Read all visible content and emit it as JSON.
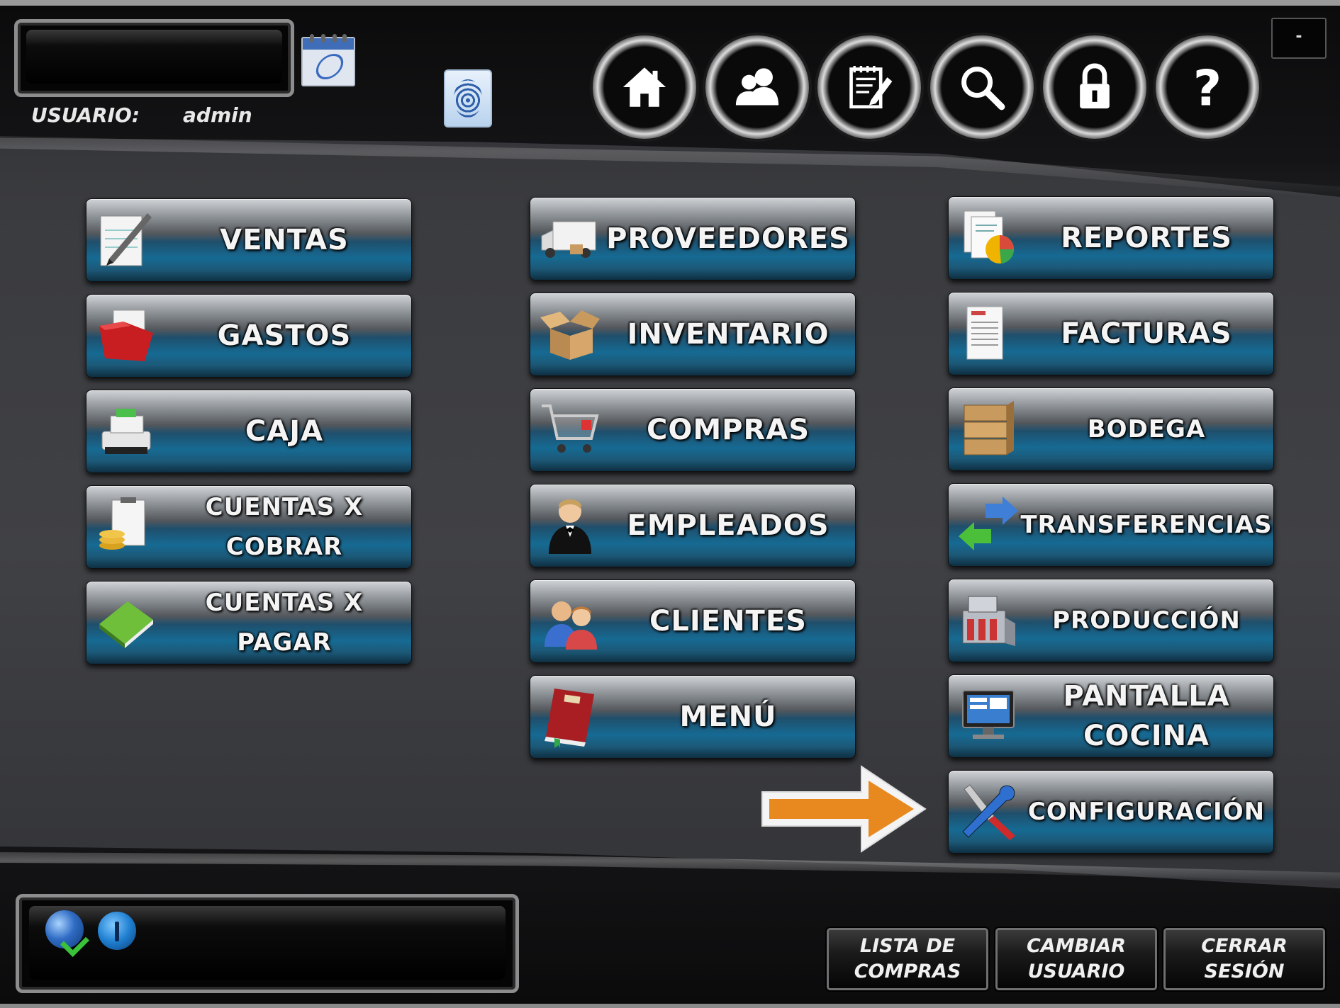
{
  "header": {
    "user_label": "USUARIO:",
    "user_value": "admin",
    "minimize_label": "-",
    "nav": [
      {
        "icon": "home-icon"
      },
      {
        "icon": "users-icon"
      },
      {
        "icon": "notepad-edit-icon"
      },
      {
        "icon": "search-icon"
      },
      {
        "icon": "lock-icon"
      },
      {
        "icon": "help-icon"
      }
    ]
  },
  "menu": {
    "col1": [
      {
        "label": "VENTAS",
        "icon": "pen-paper-icon"
      },
      {
        "label": "GASTOS",
        "icon": "red-folder-icon"
      },
      {
        "label": "CAJA",
        "icon": "cash-register-icon"
      },
      {
        "label": "CUENTAS X\nCOBRAR",
        "icon": "coins-clipboard-icon"
      },
      {
        "label": "CUENTAS X\nPAGAR",
        "icon": "green-book-icon"
      }
    ],
    "col2": [
      {
        "label": "PROVEEDORES",
        "icon": "delivery-truck-icon"
      },
      {
        "label": "INVENTARIO",
        "icon": "open-box-icon"
      },
      {
        "label": "COMPRAS",
        "icon": "shopping-cart-icon"
      },
      {
        "label": "EMPLEADOS",
        "icon": "waiter-icon"
      },
      {
        "label": "CLIENTES",
        "icon": "people-icon"
      },
      {
        "label": "MENÚ",
        "icon": "menu-book-icon"
      }
    ],
    "col3": [
      {
        "label": "REPORTES",
        "icon": "report-chart-icon"
      },
      {
        "label": "FACTURAS",
        "icon": "invoice-icon"
      },
      {
        "label": "BODEGA",
        "icon": "boxes-icon"
      },
      {
        "label": "TRANSFERENCIAS",
        "icon": "transfer-arrows-icon"
      },
      {
        "label": "PRODUCCIÓN",
        "icon": "factory-icon"
      },
      {
        "label": "PANTALLA\nCOCINA",
        "icon": "monitor-icon"
      },
      {
        "label": "CONFIGURACIÓN",
        "icon": "tools-icon"
      }
    ]
  },
  "colors": {
    "accent_arrow": "#e8891f",
    "button_blue": "#166a93"
  },
  "footer": {
    "status_icons": [
      "globe-check-icon",
      "signal-icon"
    ],
    "buttons": [
      {
        "label": "LISTA DE\nCOMPRAS"
      },
      {
        "label": "CAMBIAR\nUSUARIO"
      },
      {
        "label": "CERRAR\nSESIÓN"
      }
    ]
  }
}
